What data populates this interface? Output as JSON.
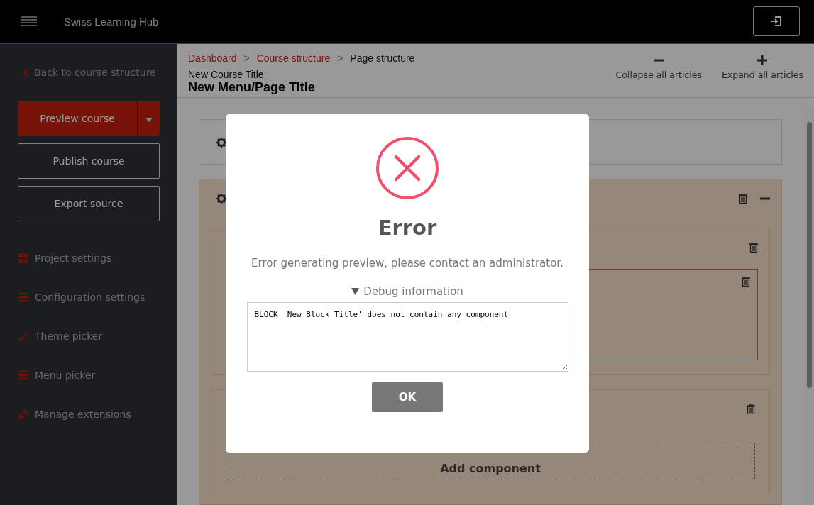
{
  "app": {
    "title": "Swiss Learning Hub"
  },
  "sidebar": {
    "back_link": "Back to course structure",
    "buttons": [
      {
        "label": "Preview course",
        "kind": "primary"
      },
      {
        "label": "Publish course",
        "kind": "outline"
      },
      {
        "label": "Export source",
        "kind": "outline"
      }
    ],
    "items": [
      {
        "label": "Project settings"
      },
      {
        "label": "Configuration settings"
      },
      {
        "label": "Theme picker"
      },
      {
        "label": "Menu picker"
      },
      {
        "label": "Manage extensions"
      }
    ]
  },
  "breadcrumb": [
    {
      "label": "Dashboard",
      "kind": "link"
    },
    {
      "label": ">",
      "kind": "separator"
    },
    {
      "label": "Course structure",
      "kind": "link"
    },
    {
      "label": ">",
      "kind": "separator"
    },
    {
      "label": "Page structure",
      "kind": "current"
    }
  ],
  "course_title": "New Course Title",
  "page_title": "New Menu/Page Title",
  "actions": [
    {
      "label": "Collapse all articles",
      "kind": "collapse"
    },
    {
      "label": "Expand all articles",
      "kind": "expand"
    }
  ],
  "content": {
    "add_component": "Add component"
  },
  "dialog": {
    "title": "Error",
    "message": "Error generating preview, please contact an administrator.",
    "debug_label": "Debug information",
    "debug_expanded": true,
    "debug_text": "BLOCK 'New Block Title' does not contain any component",
    "button": "OK"
  }
}
